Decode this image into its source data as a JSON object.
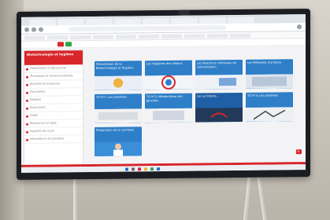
{
  "sidebar": {
    "header": "Biotechnologie et hygiène",
    "items": [
      "Présentation et découverte",
      "Techniques et travaux pratiques",
      "Activités et ressources",
      "Documents",
      "Modules",
      "Évaluations",
      "Outils",
      "Ressources en ligne",
      "Supports de cours",
      "Informations et actualités"
    ]
  },
  "cards": [
    {
      "title": "Présentation de la Biotechnologie et Hygiène"
    },
    {
      "title": "Les Hygiènes des milieux"
    },
    {
      "title": "Les Réactions chimiques de l'alimentation"
    },
    {
      "title": "Les Méthodes d'analyse"
    },
    {
      "title": "TD N°1: Les protéines"
    },
    {
      "title": "TD N°2: Métabolisme des glucides"
    },
    {
      "title": "Les accidents..."
    },
    {
      "title": "TD N°3: Les protéines"
    },
    {
      "title": "Préparation de la synthèse"
    }
  ],
  "colors": {
    "accent": "#d8262b",
    "card": "#2e7fc8",
    "card_dark": "#1f5fa6"
  }
}
